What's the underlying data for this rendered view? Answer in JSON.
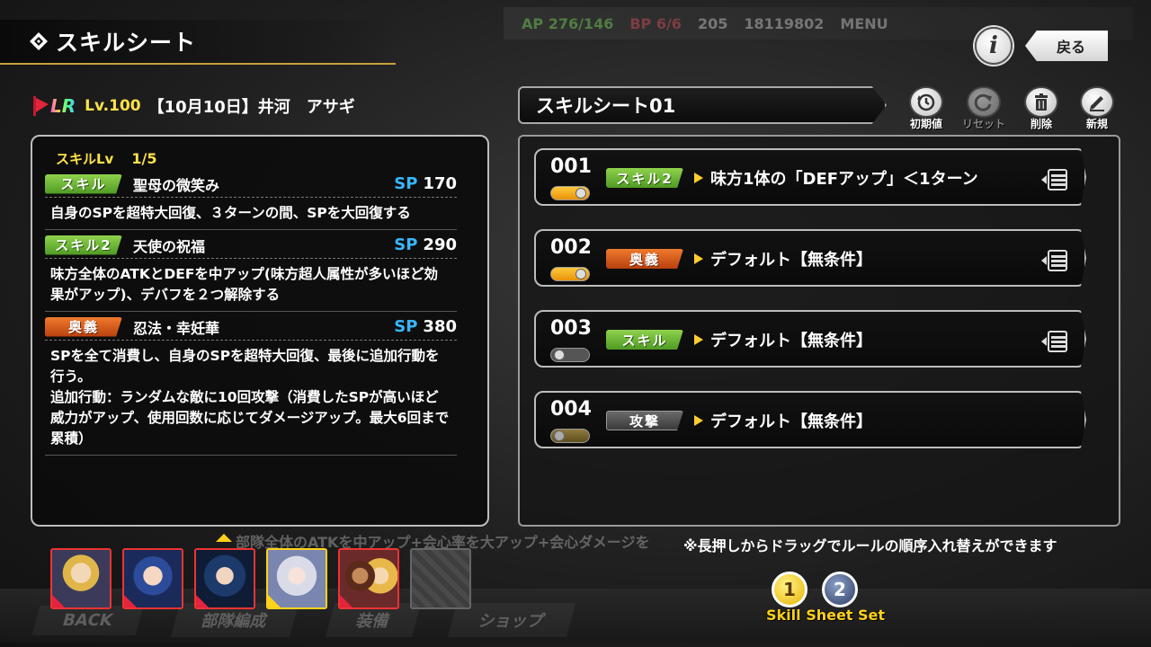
{
  "header": {
    "title": "スキルシート",
    "back_label": "戻る",
    "info_label": "i"
  },
  "hud": {
    "ap_label": "AP",
    "ap_value": "276/146",
    "bp_label": "BP",
    "bp_value": "6/6",
    "gems": "205",
    "gold": "18119802",
    "menu_label": "MENU"
  },
  "character": {
    "rarity": "LR",
    "level": "Lv.100",
    "name": "【10月10日】井河　アサギ"
  },
  "skill_panel": {
    "skill_lv_label": "スキルLv",
    "skill_lv_value": "1/5",
    "skills": [
      {
        "tag": "スキル",
        "tag_color": "green",
        "name": "聖母の微笑み",
        "sp_label": "SP",
        "sp": "170",
        "description": "自身のSPを超特大回復、３ターンの間、SPを大回復する"
      },
      {
        "tag": "スキル2",
        "tag_color": "green",
        "name": "天使の祝福",
        "sp_label": "SP",
        "sp": "290",
        "description": "味方全体のATKとDEFを中アップ(味方超人属性が多いほど効果がアップ)、デバフを２つ解除する"
      },
      {
        "tag": "奥義",
        "tag_color": "orange",
        "name": "忍法・幸妊華",
        "sp_label": "SP",
        "sp": "380",
        "description": "SPを全て消費し、自身のSPを超特大回復、最後に追加行動を行う。\n追加行動：ランダムな敵に10回攻撃（消費したSPが高いほど威力がアップ、使用回数に応じてダメージアップ。最大6回まで累積）"
      }
    ]
  },
  "sheet": {
    "title": "スキルシート01",
    "tools": [
      {
        "label": "初期値",
        "icon": "history-icon",
        "enabled": true
      },
      {
        "label": "リセット",
        "icon": "reset-icon",
        "enabled": false
      },
      {
        "label": "削除",
        "icon": "trash-icon",
        "enabled": true
      },
      {
        "label": "新規",
        "icon": "pencil-icon",
        "enabled": true
      }
    ],
    "rules": [
      {
        "num": "001",
        "toggle": "on",
        "tag": "スキル2",
        "tag_color": "green",
        "text": "味方1体の「DEFアップ」＜1ターン",
        "draggable": true
      },
      {
        "num": "002",
        "toggle": "on",
        "tag": "奥義",
        "tag_color": "orange",
        "text": "デフォルト【無条件】",
        "draggable": true
      },
      {
        "num": "003",
        "toggle": "off",
        "tag": "スキル",
        "tag_color": "green",
        "text": "デフォルト【無条件】",
        "draggable": true
      },
      {
        "num": "004",
        "toggle": "dim",
        "tag": "攻撃",
        "tag_color": "grey",
        "text": "デフォルト【無条件】",
        "draggable": false
      }
    ],
    "note": "※長押しからドラッグでルールの順序入れ替えができます"
  },
  "ticker": "部隊全体のATKを中アップ+会心率を大アップ+会心ダメージを",
  "pager": {
    "pages": [
      "1",
      "2"
    ],
    "active": "1",
    "label": "Skill Sheet Set"
  },
  "bottom_nav": [
    "BACK",
    "部隊編成",
    "装備",
    "ショップ"
  ],
  "colors": {
    "accent_gold": "#c9a03a",
    "sp_blue": "#38b6ff",
    "tag_green": "#6bb83a",
    "tag_orange": "#d85a1e",
    "level_yellow": "#ffe14a"
  }
}
